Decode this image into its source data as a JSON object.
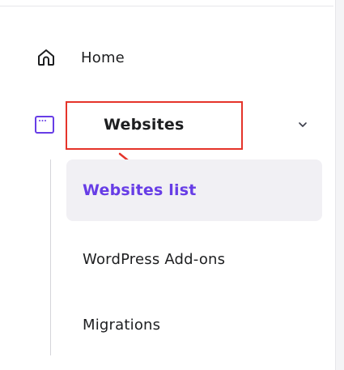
{
  "nav": {
    "home": {
      "label": "Home",
      "icon": "home-icon"
    },
    "websites": {
      "label": "Websites",
      "icon": "browser-window-icon",
      "expanded": true,
      "chevron_icon": "chevron-down-icon"
    },
    "sub_items": [
      {
        "label": "Websites list",
        "active": true
      },
      {
        "label": "WordPress Add-ons",
        "active": false
      },
      {
        "label": "Migrations",
        "active": false
      }
    ]
  },
  "colors": {
    "accent": "#673de6",
    "annotation": "#e5342a",
    "text": "#1d1e20",
    "active_bg": "#f1f0f4"
  }
}
